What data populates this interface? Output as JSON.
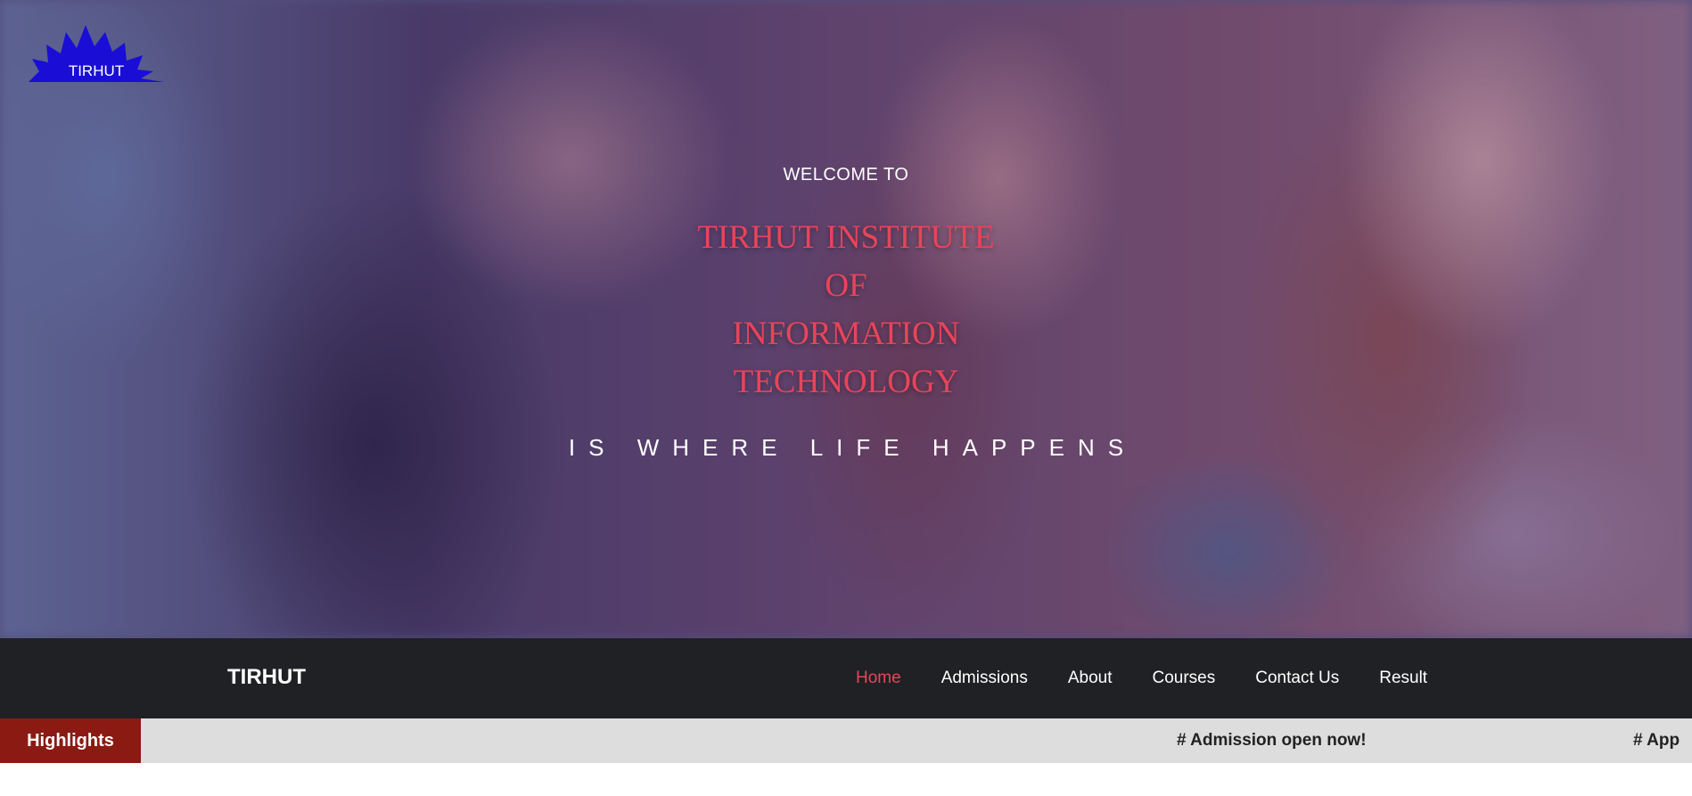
{
  "logo": {
    "text": "TIRHUT",
    "icon": "starburst-logo-icon",
    "color": "#1a0ed6"
  },
  "hero": {
    "welcome": "WELCOME TO",
    "title_lines": [
      "TIRHUT INSTITUTE",
      "OF",
      "INFORMATION",
      "TECHNOLOGY"
    ],
    "tagline": "IS WHERE LIFE HAPPENS",
    "title_color": "#e8445a"
  },
  "navbar": {
    "brand": "TIRHUT",
    "links": [
      {
        "label": "Home",
        "active": true
      },
      {
        "label": "Admissions",
        "active": false
      },
      {
        "label": "About",
        "active": false
      },
      {
        "label": "Courses",
        "active": false
      },
      {
        "label": "Contact Us",
        "active": false
      },
      {
        "label": "Result",
        "active": false
      }
    ],
    "background": "#1f2124",
    "active_color": "#e8445a"
  },
  "highlights": {
    "label": "Highlights",
    "items": [
      "# Admission open now!",
      "# App"
    ],
    "label_background": "#8b1a12"
  }
}
